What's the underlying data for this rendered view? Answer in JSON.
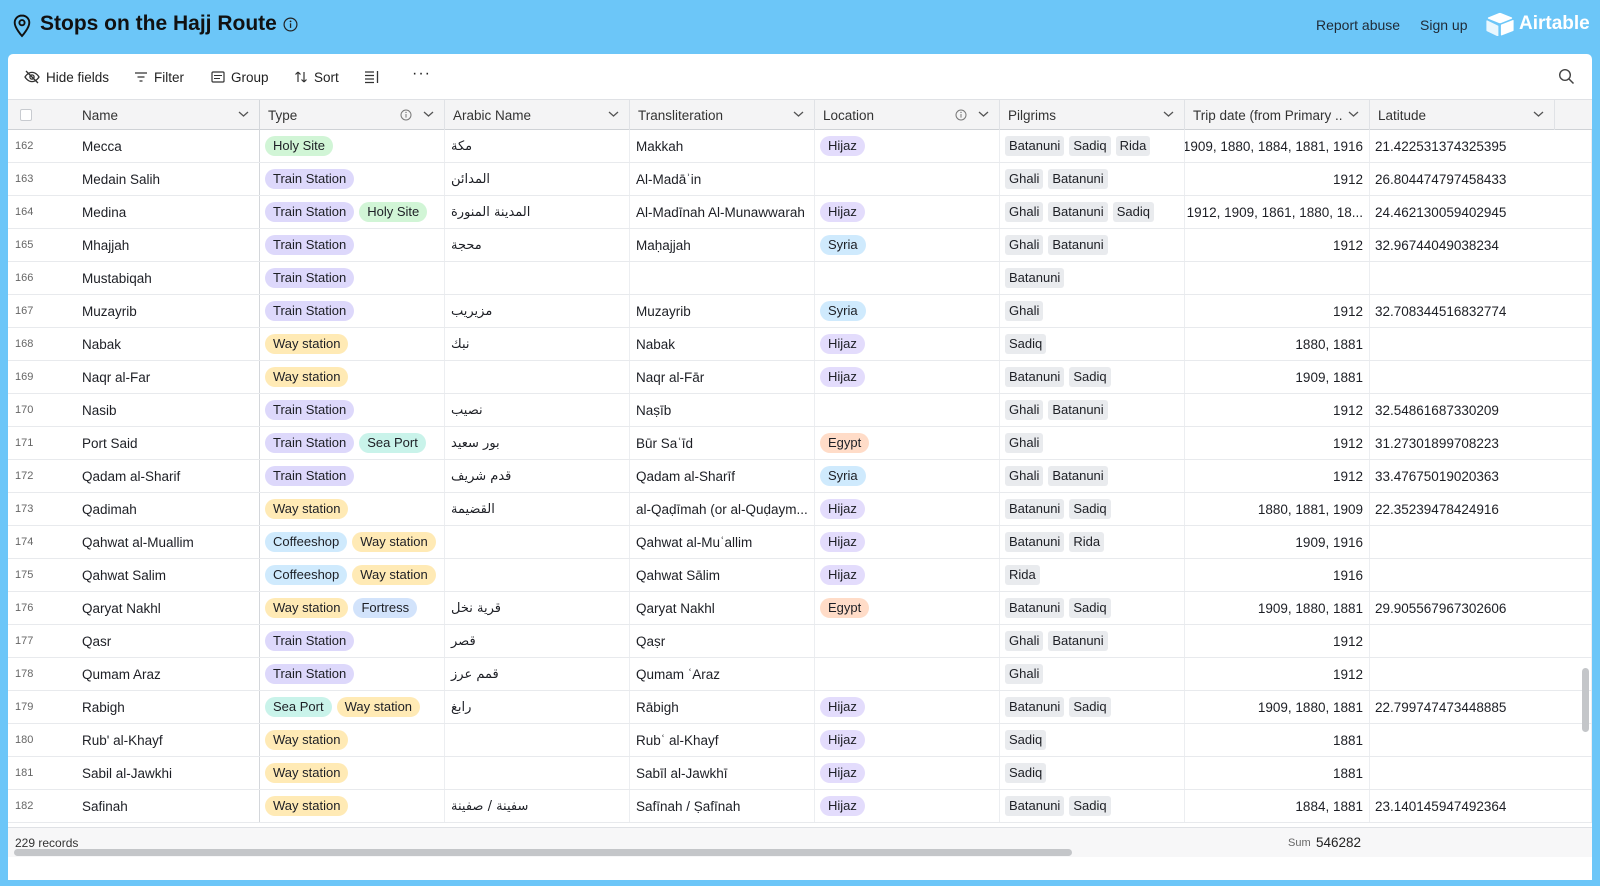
{
  "header": {
    "title": "Stops on the Hajj Route",
    "report_abuse": "Report abuse",
    "sign_up": "Sign up",
    "brand": "Airtable"
  },
  "toolbar": {
    "hide_fields": "Hide fields",
    "filter": "Filter",
    "group": "Group",
    "sort": "Sort",
    "more": "···"
  },
  "columns": {
    "name": "Name",
    "type": "Type",
    "arabic": "Arabic Name",
    "transliteration": "Transliteration",
    "location": "Location",
    "pilgrims": "Pilgrims",
    "trip_date": "Trip date (from Primary ...",
    "latitude": "Latitude"
  },
  "colors": {
    "background": "#6cc6f8",
    "Holy Site": "#d1f5d6",
    "Train Station": "#ddd8fb",
    "Way station": "#ffeab5",
    "Sea Port": "#c9f3ea",
    "Coffeeshop": "#cfeafd",
    "Fortress": "#d2e3fb",
    "Hijaz": "#e3dcfc",
    "Syria": "#cfeafd",
    "Egypt": "#ffdcc8"
  },
  "rows": [
    {
      "num": "162",
      "name": "Mecca",
      "types": [
        "Holy Site"
      ],
      "arabic": "مكة",
      "trans": "Makkah",
      "location": "Hijaz",
      "pilgrims": [
        "Batanuni",
        "Sadiq",
        "Rida"
      ],
      "trip": "1909, 1880, 1884, 1881, 1916",
      "lat": "21.422531374325395"
    },
    {
      "num": "163",
      "name": "Medain Salih",
      "types": [
        "Train Station"
      ],
      "arabic": "المدائن",
      "trans": "Al-Madāʾin",
      "location": "",
      "pilgrims": [
        "Ghali",
        "Batanuni"
      ],
      "trip": "1912",
      "lat": "26.804474797458433"
    },
    {
      "num": "164",
      "name": "Medina",
      "types": [
        "Train Station",
        "Holy Site"
      ],
      "arabic": "المدينة المنورة",
      "trans": "Al-Madīnah Al-Munawwarah",
      "location": "Hijaz",
      "pilgrims": [
        "Ghali",
        "Batanuni",
        "Sadiq"
      ],
      "trip": "1912, 1909, 1861, 1880, 18...",
      "lat": "24.462130059402945"
    },
    {
      "num": "165",
      "name": "Mhajjah",
      "types": [
        "Train Station"
      ],
      "arabic": "محجة",
      "trans": "Maḥajjah",
      "location": "Syria",
      "pilgrims": [
        "Ghali",
        "Batanuni"
      ],
      "trip": "1912",
      "lat": "32.96744049038234"
    },
    {
      "num": "166",
      "name": "Mustabiqah",
      "types": [
        "Train Station"
      ],
      "arabic": "",
      "trans": "",
      "location": "",
      "pilgrims": [
        "Batanuni"
      ],
      "trip": "",
      "lat": ""
    },
    {
      "num": "167",
      "name": "Muzayrib",
      "types": [
        "Train Station"
      ],
      "arabic": "مزيريب",
      "trans": "Muzayrib",
      "location": "Syria",
      "pilgrims": [
        "Ghali"
      ],
      "trip": "1912",
      "lat": "32.708344516832774"
    },
    {
      "num": "168",
      "name": "Nabak",
      "types": [
        "Way station"
      ],
      "arabic": "نبك",
      "trans": "Nabak",
      "location": "Hijaz",
      "pilgrims": [
        "Sadiq"
      ],
      "trip": "1880, 1881",
      "lat": ""
    },
    {
      "num": "169",
      "name": "Naqr al-Far",
      "types": [
        "Way station"
      ],
      "arabic": "",
      "trans": "Naqr al-Fār",
      "location": "Hijaz",
      "pilgrims": [
        "Batanuni",
        "Sadiq"
      ],
      "trip": "1909, 1881",
      "lat": ""
    },
    {
      "num": "170",
      "name": "Nasib",
      "types": [
        "Train Station"
      ],
      "arabic": "نصيب",
      "trans": "Naṣīb",
      "location": "",
      "pilgrims": [
        "Ghali",
        "Batanuni"
      ],
      "trip": "1912",
      "lat": "32.54861687330209"
    },
    {
      "num": "171",
      "name": "Port Said",
      "types": [
        "Train Station",
        "Sea Port"
      ],
      "arabic": "بور سعيد",
      "trans": "Būr Saʿīd",
      "location": "Egypt",
      "pilgrims": [
        "Ghali"
      ],
      "trip": "1912",
      "lat": "31.27301899708223"
    },
    {
      "num": "172",
      "name": "Qadam al-Sharif",
      "types": [
        "Train Station"
      ],
      "arabic": "قدم شريف",
      "trans": "Qadam al-Sharīf",
      "location": "Syria",
      "pilgrims": [
        "Ghali",
        "Batanuni"
      ],
      "trip": "1912",
      "lat": "33.47675019020363"
    },
    {
      "num": "173",
      "name": "Qadimah",
      "types": [
        "Way station"
      ],
      "arabic": "القضيمة",
      "trans": "al-Qaḍīmah (or al-Quḍaym...",
      "location": "Hijaz",
      "pilgrims": [
        "Batanuni",
        "Sadiq"
      ],
      "trip": "1880, 1881, 1909",
      "lat": "22.35239478424916"
    },
    {
      "num": "174",
      "name": "Qahwat al-Muallim",
      "types": [
        "Coffeeshop",
        "Way station"
      ],
      "arabic": "",
      "trans": "Qahwat al-Muʿallim",
      "location": "Hijaz",
      "pilgrims": [
        "Batanuni",
        "Rida"
      ],
      "trip": "1909, 1916",
      "lat": ""
    },
    {
      "num": "175",
      "name": "Qahwat Salim",
      "types": [
        "Coffeeshop",
        "Way station"
      ],
      "arabic": "",
      "trans": "Qahwat Sālim",
      "location": "Hijaz",
      "pilgrims": [
        "Rida"
      ],
      "trip": "1916",
      "lat": ""
    },
    {
      "num": "176",
      "name": "Qaryat Nakhl",
      "types": [
        "Way station",
        "Fortress"
      ],
      "arabic": "قرية نخل",
      "trans": "Qaryat Nakhl",
      "location": "Egypt",
      "pilgrims": [
        "Batanuni",
        "Sadiq"
      ],
      "trip": "1909, 1880, 1881",
      "lat": "29.905567967302606"
    },
    {
      "num": "177",
      "name": "Qasr",
      "types": [
        "Train Station"
      ],
      "arabic": "قصر",
      "trans": "Qaṣr",
      "location": "",
      "pilgrims": [
        "Ghali",
        "Batanuni"
      ],
      "trip": "1912",
      "lat": ""
    },
    {
      "num": "178",
      "name": "Qumam Araz",
      "types": [
        "Train Station"
      ],
      "arabic": "قمم عرز",
      "trans": "Qumam ʿAraz",
      "location": "",
      "pilgrims": [
        "Ghali"
      ],
      "trip": "1912",
      "lat": ""
    },
    {
      "num": "179",
      "name": "Rabigh",
      "types": [
        "Sea Port",
        "Way station"
      ],
      "arabic": "رابغ",
      "trans": "Rābigh",
      "location": "Hijaz",
      "pilgrims": [
        "Batanuni",
        "Sadiq"
      ],
      "trip": "1909, 1880, 1881",
      "lat": "22.799747473448885"
    },
    {
      "num": "180",
      "name": "Rub' al-Khayf",
      "types": [
        "Way station"
      ],
      "arabic": "",
      "trans": "Rubʿ al-Khayf",
      "location": "Hijaz",
      "pilgrims": [
        "Sadiq"
      ],
      "trip": "1881",
      "lat": ""
    },
    {
      "num": "181",
      "name": "Sabil al-Jawkhi",
      "types": [
        "Way station"
      ],
      "arabic": "",
      "trans": "Sabīl al-Jawkhī",
      "location": "Hijaz",
      "pilgrims": [
        "Sadiq"
      ],
      "trip": "1881",
      "lat": ""
    },
    {
      "num": "182",
      "name": "Safinah",
      "types": [
        "Way station"
      ],
      "arabic": "سفينة / صفينة",
      "trans": "Safīnah / Ṣafīnah",
      "location": "Hijaz",
      "pilgrims": [
        "Batanuni",
        "Sadiq"
      ],
      "trip": "1884, 1881",
      "lat": "23.140145947492364"
    }
  ],
  "footer": {
    "records": "229 records",
    "sum_label": "Sum",
    "sum_value": "546282"
  }
}
